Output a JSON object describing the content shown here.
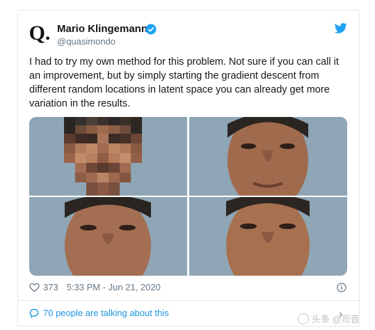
{
  "tweet": {
    "author_name": "Mario Klingemann",
    "handle": "@quasimondo",
    "avatar_letter": "Q.",
    "text": "I had to try my own method for this problem. Not sure if you can call it an improvement, but by simply starting the gradient descent from different random locations in latent space you can already get more variation in the results.",
    "likes": "373",
    "timestamp": "5:33 PM - Jun 21, 2020",
    "talking": "70 people are talking about this"
  },
  "icons": {
    "verified": "verified-badge-icon",
    "brand": "twitter-bird-icon",
    "like": "heart-icon",
    "info": "info-icon",
    "talk": "comment-bubble-icon",
    "chevron": "chevron-right-icon"
  },
  "watermark": {
    "text": "头条 @司音"
  },
  "colors": {
    "accent": "#1da1f2",
    "link": "#1b95e0",
    "muted": "#657786",
    "border": "#e1e8ed"
  }
}
